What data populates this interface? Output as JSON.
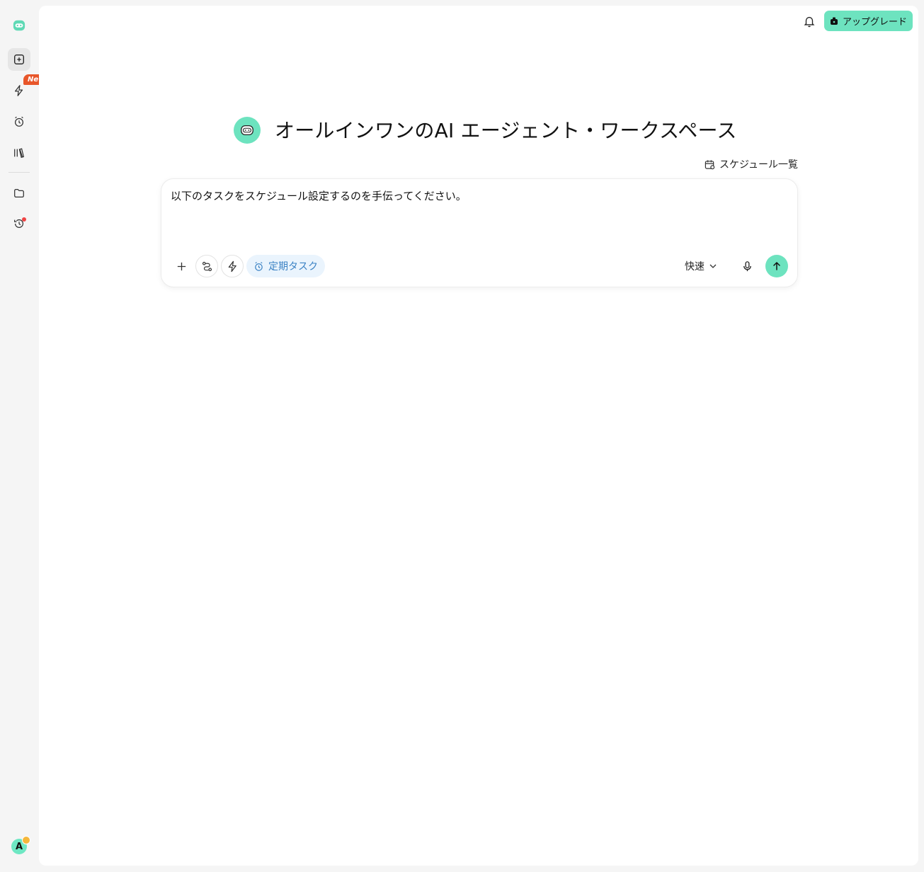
{
  "sidebar": {
    "new_badge": "New",
    "avatar_initial": "A",
    "items": [
      {
        "icon": "app-logo-icon"
      },
      {
        "icon": "new-chat-icon"
      },
      {
        "icon": "lightning-icon"
      },
      {
        "icon": "alarm-clock-icon"
      },
      {
        "icon": "library-icon"
      },
      {
        "icon": "folder-icon"
      },
      {
        "icon": "history-icon"
      }
    ]
  },
  "header": {
    "upgrade_label": "アップグレード",
    "bell_icon": "bell-icon"
  },
  "hero": {
    "title": "オールインワンのAI エージェント・ワークスペース"
  },
  "schedule_link": {
    "label": "スケジュール一覧"
  },
  "composer": {
    "input_value": "以下のタスクをスケジュール設定するのを手伝ってください。",
    "task_chip_label": "定期タスク",
    "speed_label": "快速"
  },
  "colors": {
    "accent": "#6de3bf",
    "chip_text": "#3b82c4",
    "chip_bg": "#eaf4fd",
    "new_badge": "#e8562a"
  }
}
